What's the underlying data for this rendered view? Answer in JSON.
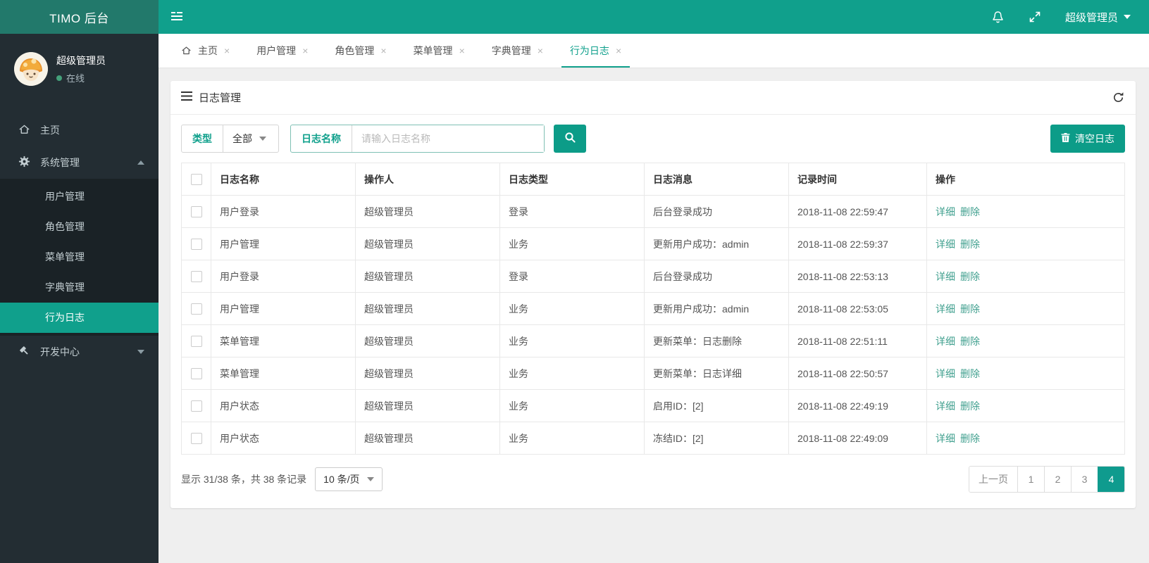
{
  "app": {
    "title": "TIMO 后台"
  },
  "topbar": {
    "user_label": "超级管理员",
    "icons": [
      "sidebar-toggle-icon",
      "bell-icon",
      "fullscreen-icon",
      "caret-down-icon"
    ]
  },
  "sidebar": {
    "user": {
      "name": "超级管理员",
      "status": "在线"
    },
    "items": [
      {
        "label": "主页",
        "icon": "home-icon"
      },
      {
        "label": "系统管理",
        "icon": "gear-icon",
        "state": "expanded"
      },
      {
        "label": "开发中心",
        "icon": "hammer-icon",
        "state": "collapsed"
      }
    ],
    "submenu": [
      {
        "label": "用户管理"
      },
      {
        "label": "角色管理"
      },
      {
        "label": "菜单管理"
      },
      {
        "label": "字典管理"
      },
      {
        "label": "行为日志",
        "active": true
      }
    ]
  },
  "tabs": [
    {
      "label": "主页",
      "icon": "home-icon"
    },
    {
      "label": "用户管理"
    },
    {
      "label": "角色管理"
    },
    {
      "label": "菜单管理"
    },
    {
      "label": "字典管理"
    },
    {
      "label": "行为日志",
      "active": true
    }
  ],
  "panel": {
    "title": "日志管理",
    "filter": {
      "type_label": "类型",
      "type_value": "全部",
      "name_label": "日志名称",
      "name_placeholder": "请输入日志名称",
      "clear_button": "清空日志"
    },
    "table": {
      "headers": [
        "日志名称",
        "操作人",
        "日志类型",
        "日志消息",
        "记录时间",
        "操作"
      ],
      "action_detail": "详细",
      "action_delete": "删除",
      "rows": [
        {
          "name": "用户登录",
          "operator": "超级管理员",
          "type": "登录",
          "message": "后台登录成功",
          "time": "2018-11-08 22:59:47"
        },
        {
          "name": "用户管理",
          "operator": "超级管理员",
          "type": "业务",
          "message": "更新用户成功：admin",
          "time": "2018-11-08 22:59:37"
        },
        {
          "name": "用户登录",
          "operator": "超级管理员",
          "type": "登录",
          "message": "后台登录成功",
          "time": "2018-11-08 22:53:13"
        },
        {
          "name": "用户管理",
          "operator": "超级管理员",
          "type": "业务",
          "message": "更新用户成功：admin",
          "time": "2018-11-08 22:53:05"
        },
        {
          "name": "菜单管理",
          "operator": "超级管理员",
          "type": "业务",
          "message": "更新菜单：日志删除",
          "time": "2018-11-08 22:51:11"
        },
        {
          "name": "菜单管理",
          "operator": "超级管理员",
          "type": "业务",
          "message": "更新菜单：日志详细",
          "time": "2018-11-08 22:50:57"
        },
        {
          "name": "用户状态",
          "operator": "超级管理员",
          "type": "业务",
          "message": "启用ID：[2]",
          "time": "2018-11-08 22:49:19"
        },
        {
          "name": "用户状态",
          "operator": "超级管理员",
          "type": "业务",
          "message": "冻结ID：[2]",
          "time": "2018-11-08 22:49:09"
        }
      ]
    },
    "footer": {
      "info": "显示 31/38 条，共 38 条记录",
      "page_size": "10 条/页",
      "prev": "上一页",
      "pages": [
        "1",
        "2",
        "3",
        "4"
      ],
      "active_page": "4"
    }
  },
  "colors": {
    "topbar": "#10a08c",
    "logo_bg": "#22796b",
    "sidebar_bg": "#232d33",
    "submenu_bg": "#1a2226",
    "accent": "#0c9c88",
    "link": "#41a08f",
    "online_dot": "#44a07a"
  }
}
